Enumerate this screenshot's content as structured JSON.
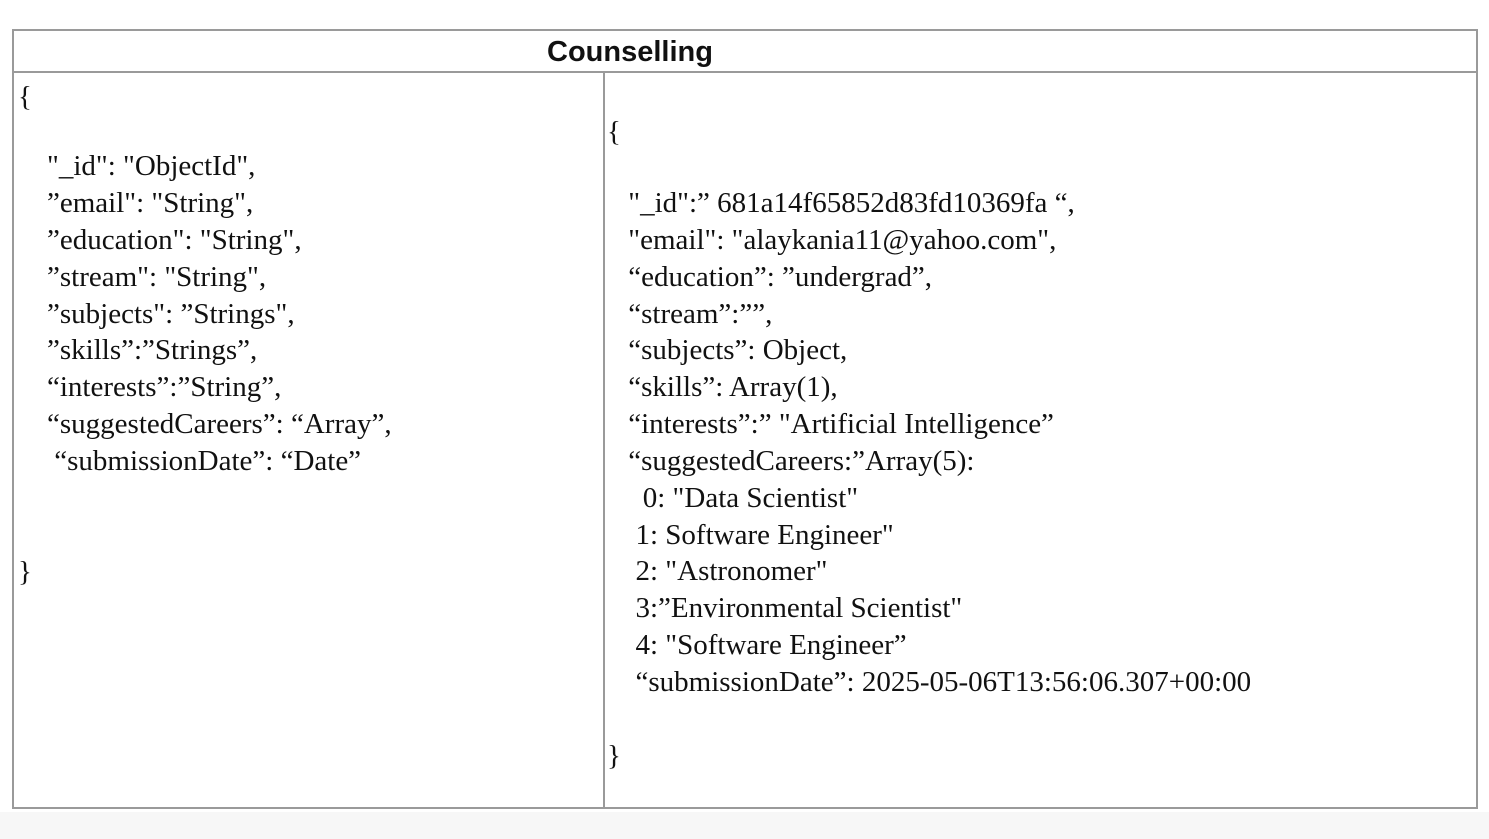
{
  "table": {
    "title": "Counselling",
    "left_cell": {
      "open_brace": "{",
      "lines": [
        "\"_id\": \"ObjectId\",",
        "”email\": \"String\",",
        "”education\": \"String\",",
        "”stream\": \"String\",",
        "”subjects\": ”Strings\",",
        "”skills”:”Strings”,",
        "“interests”:”String”,",
        "“suggestedCareers”: “Array”,",
        " “submissionDate”: “Date”"
      ],
      "close_brace": "}"
    },
    "right_cell": {
      "open_brace": "{",
      "lines": [
        " \"_id\":” 681a14f65852d83fd10369fa “,",
        " \"email\": \"alaykania11@yahoo.com\",",
        " “education”: ”undergrad”,",
        " “stream”:””,",
        " “subjects”: Object,",
        " “skills”: Array(1),",
        " “interests”:” \"Artificial Intelligence”",
        " “suggestedCareers:”Array(5):",
        "   0: \"Data Scientist\"",
        "  1: Software Engineer\"",
        "  2: \"Astronomer\"",
        "  3:”Environmental Scientist\"",
        "  4: \"Software Engineer”",
        "  “submissionDate”: 2025-05-06T13:56:06.307+00:00"
      ],
      "close_brace": "}"
    }
  }
}
